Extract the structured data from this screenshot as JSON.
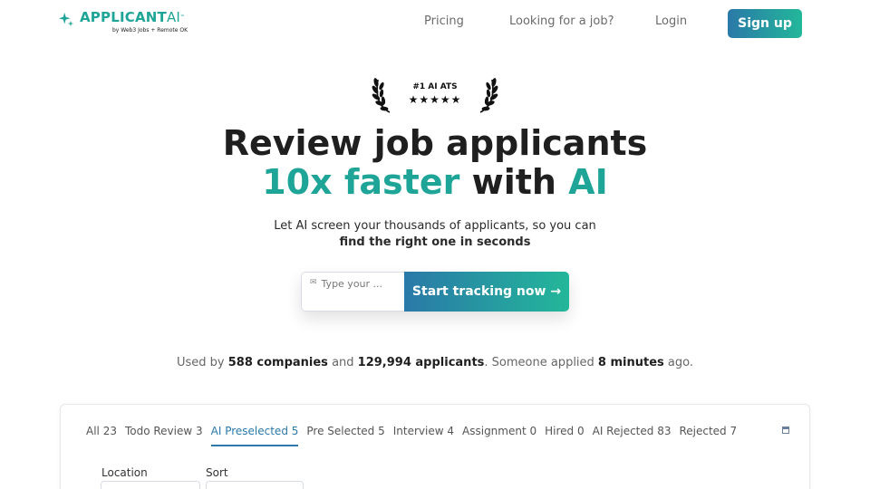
{
  "header": {
    "brand": "APPLICANT",
    "brand_suffix": "AI",
    "brand_tm": "™",
    "tagline": "by Web3 Jobs + Remote OK",
    "nav": {
      "pricing": "Pricing",
      "looking": "Looking for a job?",
      "login": "Login"
    },
    "signup": "Sign up"
  },
  "badge": {
    "title": "#1 AI ATS",
    "stars": "★★★★★"
  },
  "hero": {
    "line1": "Review job applicants",
    "line2_part1": "10x faster",
    "line2_part2": " with ",
    "line2_part3": "AI",
    "sub_line1": "Let AI screen your thousands of applicants, so you can",
    "sub_line2": "find the right one in seconds"
  },
  "cta": {
    "placeholder": "Type your ...",
    "button": "Start tracking now →"
  },
  "stats": {
    "p1": "Used by ",
    "companies": "588 companies",
    "p2": " and ",
    "applicants": "129,994 applicants",
    "p3": ". Someone applied ",
    "time": "8 minutes",
    "p4": " ago."
  },
  "panel": {
    "tabs": [
      {
        "label": "All 23"
      },
      {
        "label": "Todo Review 3"
      },
      {
        "label": "AI Preselected 5"
      },
      {
        "label": "Pre Selected 5"
      },
      {
        "label": "Interview 4"
      },
      {
        "label": "Assignment 0"
      },
      {
        "label": "Hired 0"
      },
      {
        "label": "AI Rejected 83"
      },
      {
        "label": "Rejected 7"
      }
    ],
    "active_tab": "AI Preselected 5",
    "location_label": "Location",
    "sort_label": "Sort"
  },
  "colors": {
    "accent": "#1fa598",
    "gradient_start": "#2a79a8",
    "gradient_end": "#23b79a"
  }
}
